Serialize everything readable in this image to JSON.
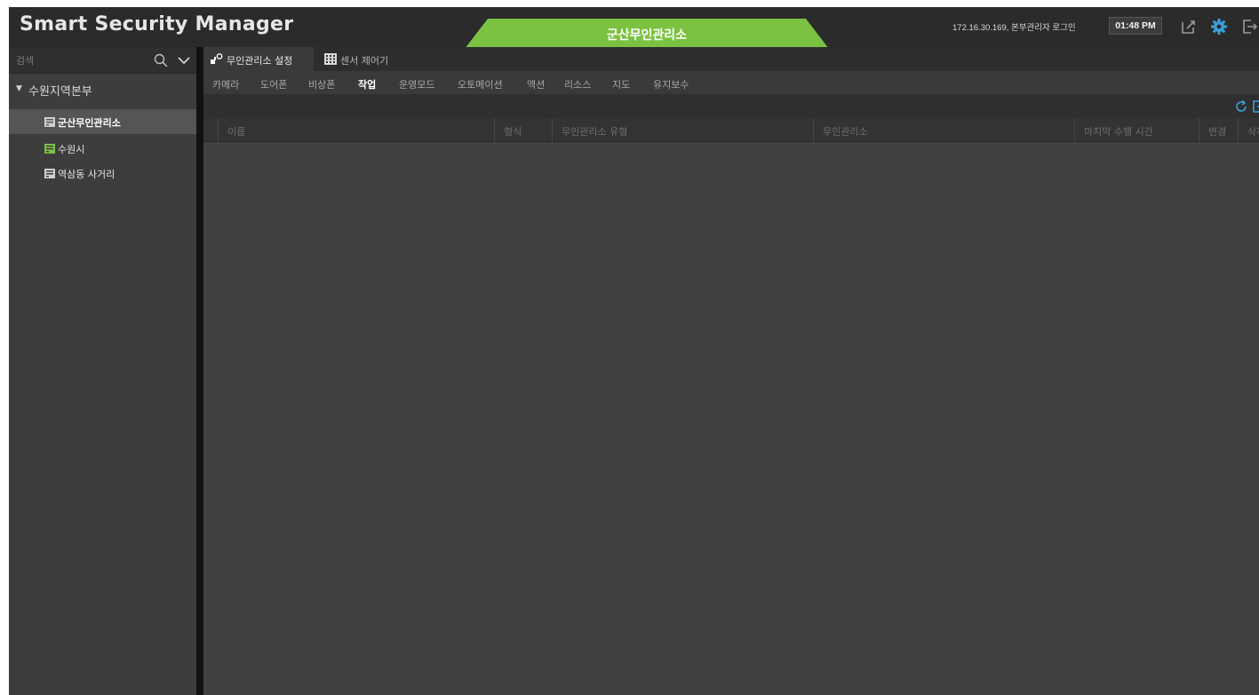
{
  "app": {
    "title": "Smart Security Manager"
  },
  "header": {
    "site_tab": "군산무인관리소",
    "login_info": "172.16.30.169, 본부관리자 로그인",
    "clock": "01:48 PM",
    "icons": [
      "edit-window-icon",
      "gear-icon",
      "logout-icon"
    ],
    "accent_color": "#7cc242",
    "gear_color": "#3aa0d8"
  },
  "sidebar": {
    "search_placeholder": "검색",
    "group": {
      "label": "수원지역본부",
      "expanded": true
    },
    "items": [
      {
        "label": "군산무인관리소",
        "selected": true,
        "icon_color": "#cfcfcf"
      },
      {
        "label": "수원시",
        "selected": false,
        "icon_color": "#7cc242"
      },
      {
        "label": "역삼동 사거리",
        "selected": false,
        "icon_color": "#cfcfcf"
      }
    ]
  },
  "main": {
    "top_tabs": [
      {
        "label": "무인관리소 설정",
        "icon": "site-settings-icon",
        "active": true
      },
      {
        "label": "센서 제어기",
        "icon": "sensor-grid-icon",
        "active": false
      }
    ],
    "sub_tabs": [
      "카메라",
      "도어폰",
      "비상폰",
      "작업",
      "운영모드",
      "오토메이션",
      "액션",
      "리소스",
      "지도",
      "유지보수"
    ],
    "active_sub_tab": "작업",
    "toolbar_icons": [
      "refresh-icon",
      "export-icon"
    ],
    "table": {
      "columns": [
        "이름",
        "형식",
        "무인관리소 유형",
        "무인관리소",
        "마지막 수행 시간",
        "변경",
        "삭제"
      ],
      "rows": []
    }
  }
}
